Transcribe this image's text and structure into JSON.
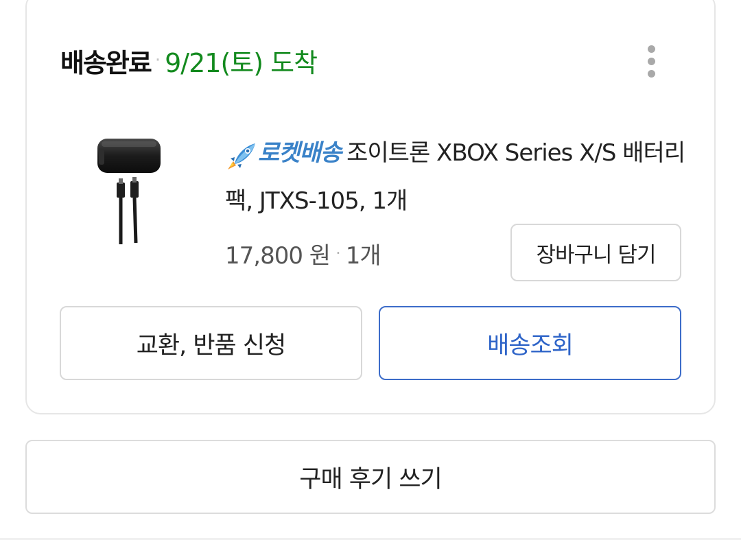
{
  "order": {
    "status": "배송완료",
    "separator": "·",
    "arrival": "9/21(토) 도착",
    "more_menu_icon": "more-vertical-icon"
  },
  "product": {
    "badge_icon": "rocket-icon",
    "badge_label": "로켓배송",
    "title": "조이트론 XBOX Series X/S 배터리 팩, JTXS-105, 1개",
    "price": "17,800 원",
    "separator": "·",
    "quantity": "1개",
    "image_alt": "battery-pack-with-usb-cable"
  },
  "buttons": {
    "add_to_cart": "장바구니 담기",
    "exchange_return": "교환, 반품 신청",
    "track_delivery": "배송조회",
    "write_review": "구매 후기 쓰기"
  },
  "colors": {
    "arrival_green": "#138a1e",
    "rocket_blue": "#3a82c8",
    "tracking_blue": "#2e64c8"
  }
}
